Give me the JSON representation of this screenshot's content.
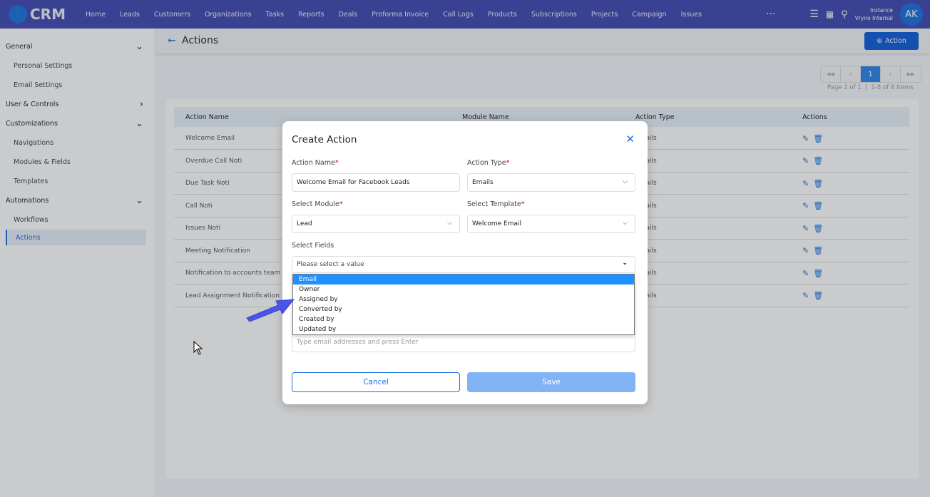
{
  "header": {
    "logo": "CRM",
    "nav": [
      "Home",
      "Leads",
      "Customers",
      "Organizations",
      "Tasks",
      "Reports",
      "Deals",
      "Proforma Invoice",
      "Call Logs",
      "Products",
      "Subscriptions",
      "Projects",
      "Campaign",
      "Issues"
    ],
    "more": "···",
    "instance_label": "Instance",
    "instance_name": "Vryno Internal",
    "avatar": "AK"
  },
  "sidebar": {
    "groups": [
      {
        "label": "General",
        "expanded": true,
        "items": [
          "Personal Settings",
          "Email Settings"
        ]
      },
      {
        "label": "User & Controls",
        "expanded": false,
        "items": []
      },
      {
        "label": "Customizations",
        "expanded": true,
        "items": [
          "Navigations",
          "Modules & Fields",
          "Templates"
        ]
      },
      {
        "label": "Automations",
        "expanded": true,
        "items": [
          "Workflows",
          "Actions"
        ]
      }
    ],
    "active": "Actions"
  },
  "page": {
    "title": "Actions",
    "add_button": "Action"
  },
  "pagination": {
    "first": "◀◀",
    "prev": "‹",
    "current": "1",
    "next": "›",
    "last": "▶▶",
    "info": "Page 1 of 1  |  1-8 of 8 Items"
  },
  "table": {
    "columns": [
      "Action Name",
      "Module Name",
      "Action Type",
      "Actions"
    ],
    "rows": [
      [
        "Welcome Email",
        "",
        "Emails"
      ],
      [
        "Overdue Call Noti",
        "",
        "Emails"
      ],
      [
        "Due Task Noti",
        "",
        "Emails"
      ],
      [
        "Call Noti",
        "",
        "Emails"
      ],
      [
        "Issues Noti",
        "",
        "Emails"
      ],
      [
        "Meeting Notification",
        "",
        "Emails"
      ],
      [
        "Notification to accounts team",
        "",
        "Emails"
      ],
      [
        "Lead Assignment Notification",
        "",
        "Emails"
      ]
    ]
  },
  "modal": {
    "title": "Create Action",
    "action_name_label": "Action Name",
    "action_name_value": "Welcome Email for Facebook Leads",
    "action_type_label": "Action Type",
    "action_type_value": "Emails",
    "module_label": "Select Module",
    "module_value": "Lead",
    "template_label": "Select Template",
    "template_value": "Welcome Email",
    "fields_label": "Select Fields",
    "fields_placeholder": "Please select a value",
    "field_options": [
      "Email",
      "Owner",
      "Assigned by",
      "Converted by",
      "Created by",
      "Updated by"
    ],
    "highlighted_option": "Email",
    "emails_placeholder": "Type email addresses and press Enter",
    "cancel": "Cancel",
    "save": "Save"
  },
  "colors": {
    "header": "#3f48b0",
    "accent": "#1a6fe0",
    "highlight": "#1e90ff",
    "save_disabled": "#82b4f5"
  }
}
